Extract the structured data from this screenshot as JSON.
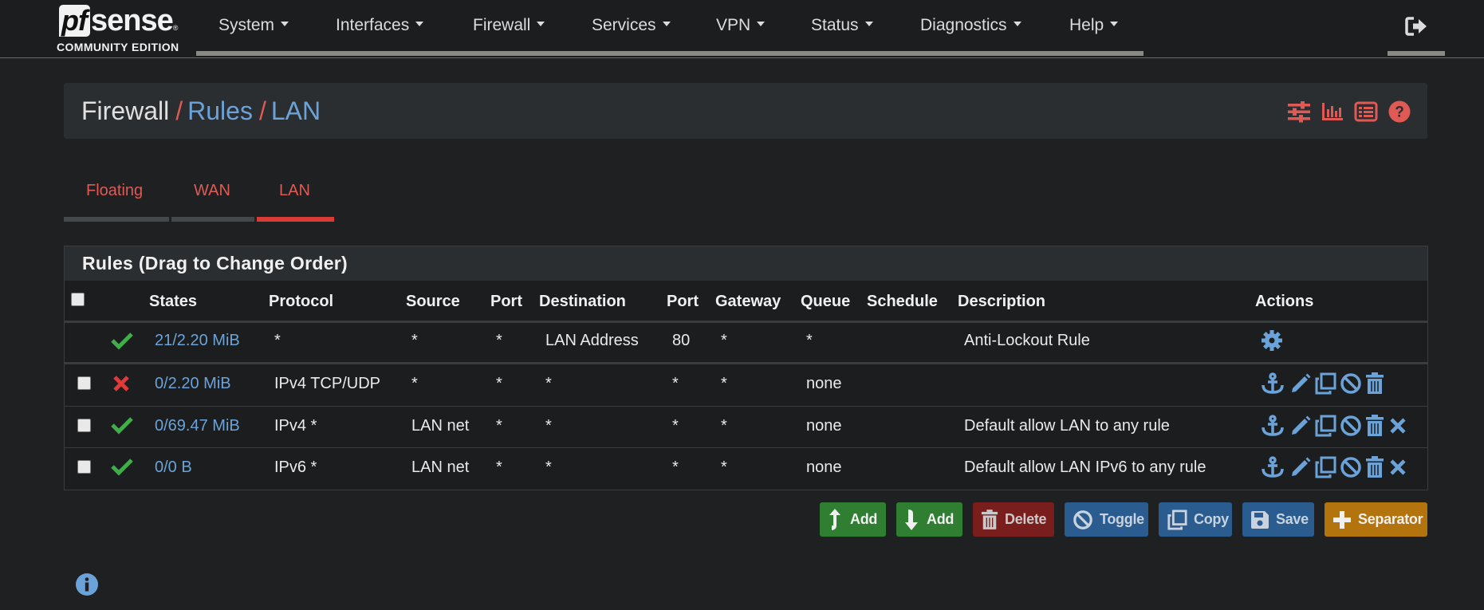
{
  "brand": {
    "logo_pf": "pf",
    "logo_sense": "sense",
    "logo_reg": "®",
    "edition": "COMMUNITY EDITION"
  },
  "nav": {
    "items": [
      {
        "label": "System"
      },
      {
        "label": "Interfaces"
      },
      {
        "label": "Firewall"
      },
      {
        "label": "Services"
      },
      {
        "label": "VPN"
      },
      {
        "label": "Status"
      },
      {
        "label": "Diagnostics"
      },
      {
        "label": "Help"
      }
    ],
    "logout_icon": "sign-out-icon"
  },
  "breadcrumb": {
    "first": "Firewall",
    "sep": "/",
    "second": "Rules",
    "third": "LAN"
  },
  "header_icons": [
    "sliders-icon",
    "bar-chart-icon",
    "list-icon",
    "help-icon"
  ],
  "tabs": [
    {
      "label": "Floating",
      "active": false
    },
    {
      "label": "WAN",
      "active": false
    },
    {
      "label": "LAN",
      "active": true
    }
  ],
  "rules": {
    "title": "Rules (Drag to Change Order)",
    "columns": {
      "states": "States",
      "protocol": "Protocol",
      "source": "Source",
      "port": "Port",
      "destination": "Destination",
      "port2": "Port",
      "gateway": "Gateway",
      "queue": "Queue",
      "schedule": "Schedule",
      "description": "Description",
      "actions": "Actions"
    },
    "rows": [
      {
        "status": "pass",
        "states": "21/2.20 MiB",
        "protocol": "*",
        "source": "*",
        "port": "*",
        "destination": "LAN Address",
        "dest_port": "80",
        "gateway": "*",
        "queue": "*",
        "schedule": "",
        "description": "Anti-Lockout Rule",
        "actions": [
          "gear-icon"
        ]
      },
      {
        "status": "block",
        "states": "0/2.20 MiB",
        "protocol": "IPv4 TCP/UDP",
        "source": "*",
        "port": "*",
        "destination": "*",
        "dest_port": "*",
        "gateway": "*",
        "queue": "none",
        "schedule": "",
        "description": "",
        "actions": [
          "anchor-icon",
          "pencil-icon",
          "copy-icon",
          "disable-icon",
          "trash-icon"
        ]
      },
      {
        "status": "pass",
        "states": "0/69.47 MiB",
        "protocol": "IPv4 *",
        "source": "LAN net",
        "port": "*",
        "destination": "*",
        "dest_port": "*",
        "gateway": "*",
        "queue": "none",
        "schedule": "",
        "description": "Default allow LAN to any rule",
        "actions": [
          "anchor-icon",
          "pencil-icon",
          "copy-icon",
          "disable-icon",
          "trash-icon",
          "delete-x-icon"
        ]
      },
      {
        "status": "pass",
        "states": "0/0 B",
        "protocol": "IPv6 *",
        "source": "LAN net",
        "port": "*",
        "destination": "*",
        "dest_port": "*",
        "gateway": "*",
        "queue": "none",
        "schedule": "",
        "description": "Default allow LAN IPv6 to any rule",
        "actions": [
          "anchor-icon",
          "pencil-icon",
          "copy-icon",
          "disable-icon",
          "trash-icon",
          "delete-x-icon"
        ]
      }
    ]
  },
  "buttons": {
    "add_top": "Add",
    "add_bottom": "Add",
    "delete": "Delete",
    "toggle": "Toggle",
    "copy": "Copy",
    "save": "Save",
    "separator": "Separator"
  },
  "colors": {
    "accent_red": "#e05a55",
    "link_blue": "#6ba3d9",
    "pass_green": "#3fae49",
    "block_red": "#e03a3a",
    "btn_green": "#2f7e31",
    "btn_orange": "#b3730d",
    "btn_blue": "#2b5c8f"
  }
}
